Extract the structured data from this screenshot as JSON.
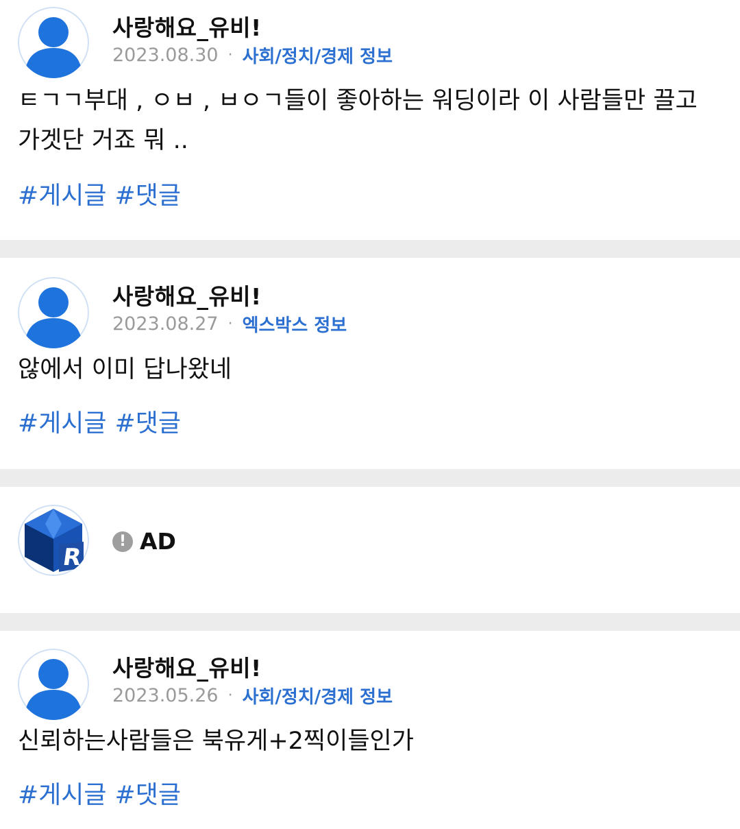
{
  "posts": [
    {
      "author": "사랑해요_유비!",
      "date": "2023.08.30",
      "separator": "·",
      "category": "사회/정치/경제 정보",
      "body": "ㅌㄱㄱ부대 , ㅇㅂ , ㅂㅇㄱ들이 좋아하는 워딩이라 이 사람들만 끌고 가겟단 거죠 뭐 ..",
      "tags": [
        "#게시글",
        "#댓글"
      ]
    },
    {
      "author": "사랑해요_유비!",
      "date": "2023.08.27",
      "separator": "·",
      "category": "엑스박스 정보",
      "body": "않에서 이미 답나왔네",
      "tags": [
        "#게시글",
        "#댓글"
      ]
    },
    {
      "author": "사랑해요_유비!",
      "date": "2023.05.26",
      "separator": "·",
      "category": "사회/정치/경제 정보",
      "body": "신뢰하는사람들은 북유게+2찍이들인가",
      "tags": [
        "#게시글",
        "#댓글"
      ]
    }
  ],
  "ad": {
    "badge": "!",
    "label": "AD",
    "logo_letter": "R"
  },
  "icons": {
    "avatar": "user-silhouette-icon",
    "ad_logo": "cube-r-logo-icon",
    "ad_badge": "exclamation-icon"
  },
  "colors": {
    "accent_blue": "#2b6fd1",
    "avatar_blue": "#1f73dc",
    "muted_gray": "#9a9a9a",
    "separator": "#ececec"
  }
}
